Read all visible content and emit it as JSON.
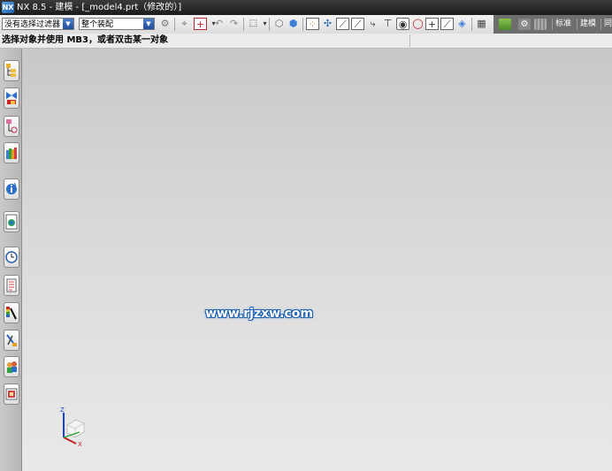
{
  "window": {
    "title": "NX 8.5 - 建模 - [_model4.prt（修改的）]",
    "logo_text": "NX"
  },
  "toolbar": {
    "selection_filter": "没有选择过滤器",
    "selection_scope": "整个装配",
    "right_tabs": [
      "标准",
      "建模",
      "同"
    ]
  },
  "prompt": {
    "text": "选择对象并使用 MB3，或者双击某一对象"
  },
  "graphics": {
    "watermark": "www.rjzxw.com",
    "triad_labels": {
      "z": "Z",
      "x": "X"
    },
    "background_top": "#c8c8c8",
    "background_bottom": "#e9e9ea"
  },
  "resource_bar": {
    "items": [
      "assembly-navigator-icon",
      "constraint-navigator-icon",
      "part-navigator-icon",
      "reuse-library-icon",
      "hd3d-tools-icon",
      "web-browser-icon",
      "history-icon",
      "process-studio-icon",
      "visualization-icon",
      "manufacturing-wizard-icon",
      "roles-icon",
      "system-scenes-icon"
    ]
  }
}
